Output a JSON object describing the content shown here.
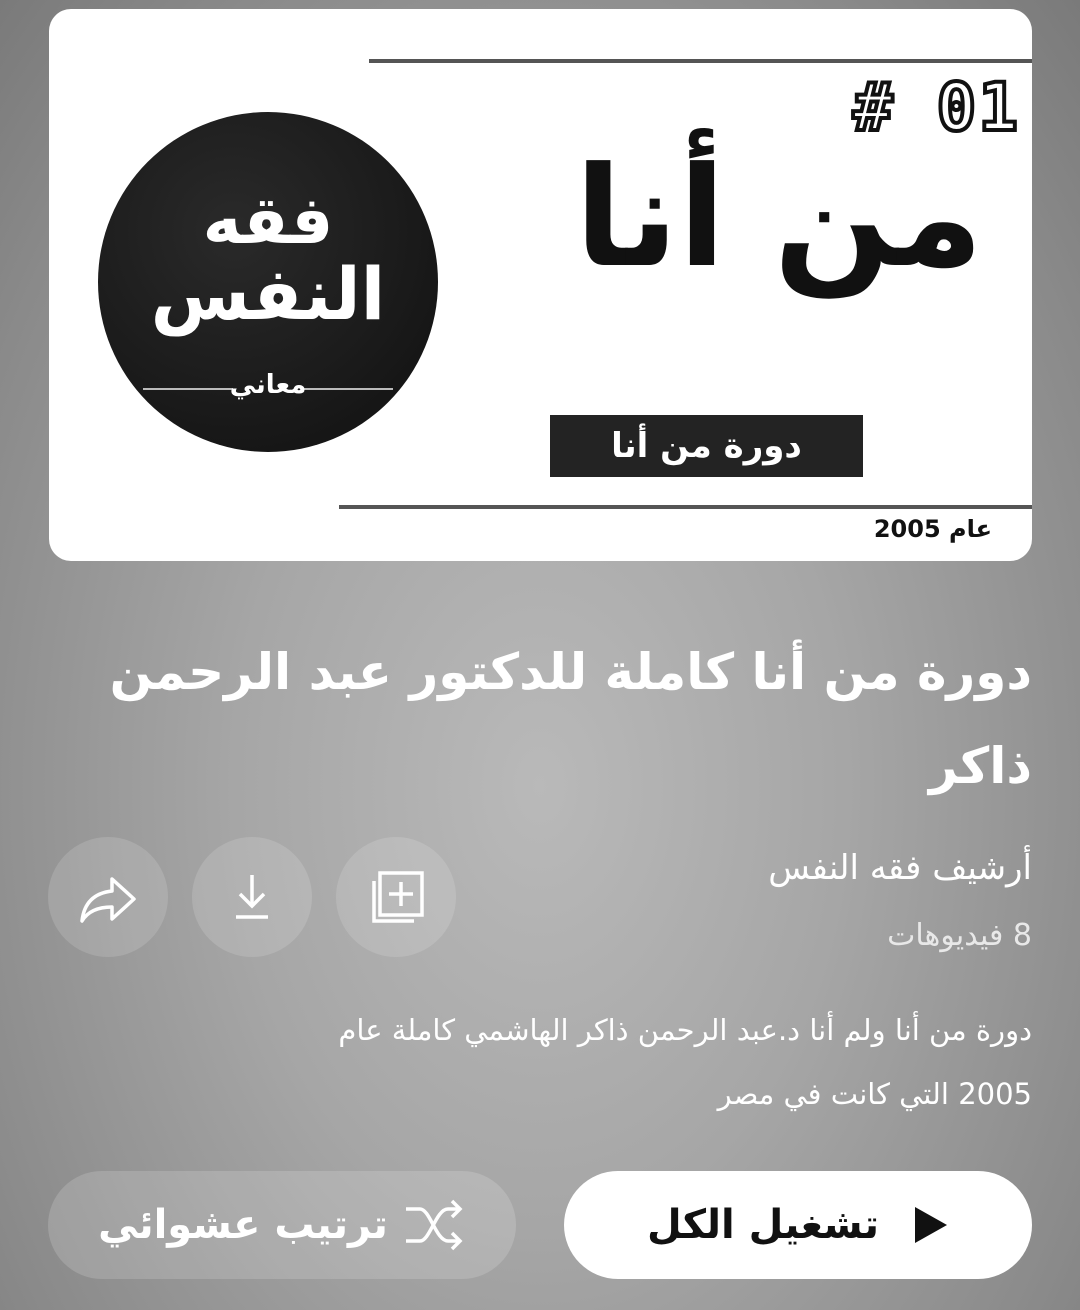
{
  "thumbnail": {
    "episode_number": "# 01",
    "main_title": "من أنا",
    "subtitle": "دورة من أنا",
    "year": "عام 2005",
    "logo_line1": "فقه",
    "logo_line2": "النفس",
    "logo_mark": "معاني"
  },
  "playlist": {
    "title": "دورة من أنا كاملة للدكتور عبد الرحمن ذاكر",
    "channel": "أرشيف فقه النفس",
    "video_count": "8 فيديوهات",
    "description": "دورة من أنا ولم أنا د.عبد الرحمن ذاكر الهاشمي كاملة عام 2005 التي كانت في مصر"
  },
  "actions": {
    "play_all": "تشغيل الكل",
    "shuffle": "ترتيب عشوائي"
  },
  "icons": {
    "share": "share-icon",
    "download": "download-icon",
    "add": "add-to-library-icon",
    "play": "play-icon",
    "shuffle": "shuffle-icon"
  }
}
